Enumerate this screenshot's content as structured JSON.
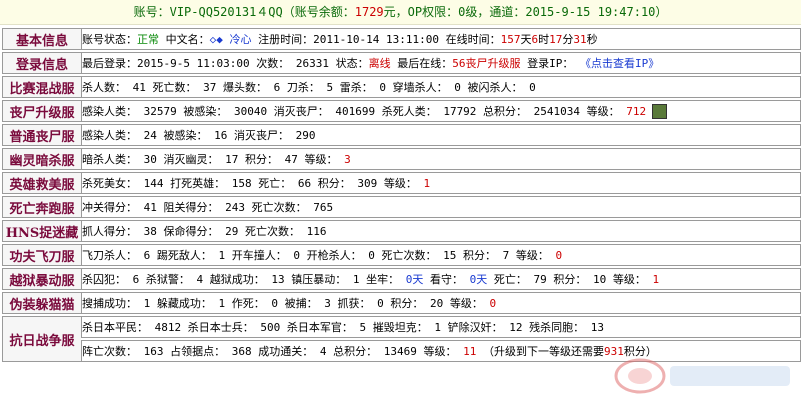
{
  "topbar": {
    "pre": "账号：VIP-QQ520131４QQ（账号余额：",
    "balance": "1729",
    "mid": "元，OP权限：0级，通道：",
    "datetime": "2015-9-15 19:47:10",
    "post": "）"
  },
  "rows": [
    {
      "label": "基本信息",
      "parts": [
        {
          "t": "账号状态：",
          "c": "kw"
        },
        {
          "t": "正常",
          "c": "green"
        },
        {
          "t": " 中文名：",
          "c": "kw"
        },
        {
          "t": "◇◆ 冷心",
          "c": "blue"
        },
        {
          "t": " 注册时间：2011-10-14 13:11:00  在线时间：",
          "c": "kw"
        },
        {
          "t": "157",
          "c": "red"
        },
        {
          "t": "天",
          "c": "kw"
        },
        {
          "t": "6",
          "c": "red"
        },
        {
          "t": "时",
          "c": "kw"
        },
        {
          "t": "17",
          "c": "red"
        },
        {
          "t": "分",
          "c": "kw"
        },
        {
          "t": "31",
          "c": "red"
        },
        {
          "t": "秒",
          "c": "kw"
        }
      ]
    },
    {
      "label": "登录信息",
      "parts": [
        {
          "t": "最后登录：2015-9-5 11:03:00 次数： 26331 状态：",
          "c": "kw"
        },
        {
          "t": "离线",
          "c": "red"
        },
        {
          "t": " 最后在线：",
          "c": "kw"
        },
        {
          "t": "56丧尸升级服",
          "c": "red"
        },
        {
          "t": " 登录IP： ",
          "c": "kw"
        },
        {
          "t": "《点击查看IP》",
          "c": "blue"
        }
      ]
    },
    {
      "label": "比赛混战服",
      "parts": [
        {
          "t": "杀人数： 41 死亡数： 37 爆头数： 6 刀杀： 5 雷杀： 0 穿墙杀人： 0 被闪杀人： 0",
          "c": "kw"
        }
      ]
    },
    {
      "label": "丧尸升级服",
      "parts": [
        {
          "t": "感染人类： 32579 被感染： 30040 消灭丧尸： 401699 杀死人类： 17792 总积分： 2541034 等级： ",
          "c": "kw"
        },
        {
          "t": "712",
          "c": "red"
        }
      ],
      "avatar": true
    },
    {
      "label": "普通丧尸服",
      "parts": [
        {
          "t": "感染人类： 24 被感染： 16 消灭丧尸： 290",
          "c": "kw"
        }
      ]
    },
    {
      "label": "幽灵暗杀服",
      "parts": [
        {
          "t": "暗杀人类： 30 消灭幽灵： 17 积分： 47 等级： ",
          "c": "kw"
        },
        {
          "t": "3",
          "c": "red"
        }
      ]
    },
    {
      "label": "英雄救美服",
      "parts": [
        {
          "t": "杀死美女： 144 打死英雄： 158 死亡： 66 积分： 309 等级： ",
          "c": "kw"
        },
        {
          "t": "1",
          "c": "red"
        }
      ]
    },
    {
      "label": "死亡奔跑服",
      "parts": [
        {
          "t": "冲关得分： 41 阻关得分： 243 死亡次数： 765",
          "c": "kw"
        }
      ]
    },
    {
      "label": "HNS捉迷藏",
      "parts": [
        {
          "t": "抓人得分： 38 保命得分： 29 死亡次数： 116",
          "c": "kw"
        }
      ]
    },
    {
      "label": "功夫飞刀服",
      "parts": [
        {
          "t": "飞刀杀人： 6 踢死敌人： 1 开车撞人： 0 开枪杀人： 0 死亡次数： 15 积分： 7 等级： ",
          "c": "kw"
        },
        {
          "t": "0",
          "c": "red"
        }
      ]
    },
    {
      "label": "越狱暴动服",
      "parts": [
        {
          "t": "杀囚犯： 6 杀狱警： 4 越狱成功： 13 镇压暴动： 1 坐牢： ",
          "c": "kw"
        },
        {
          "t": "0天",
          "c": "blue"
        },
        {
          "t": " 看守： ",
          "c": "kw"
        },
        {
          "t": "0天",
          "c": "blue"
        },
        {
          "t": " 死亡： 79 积分： 10 等级： ",
          "c": "kw"
        },
        {
          "t": "1",
          "c": "red"
        }
      ]
    },
    {
      "label": "伪装躲猫猫",
      "parts": [
        {
          "t": "搜捕成功： 1 躲藏成功： 1 作死： 0 被捕： 3 抓获： 0 积分： 20 等级： ",
          "c": "kw"
        },
        {
          "t": "0",
          "c": "red"
        }
      ]
    }
  ],
  "war": {
    "label": "抗日战争服",
    "line1": [
      {
        "t": "杀日本平民： 4812 杀日本士兵： 500 杀日本军官： 5 摧毁坦克： 1 铲除汉奸： 12 残杀同胞： 13",
        "c": "kw"
      }
    ],
    "line2": [
      {
        "t": "阵亡次数： 163 占领据点： 368 成功通关： 4 总积分： 13469 等级： ",
        "c": "kw"
      },
      {
        "t": "11",
        "c": "red"
      },
      {
        "t": " （升级到下一等级还需要",
        "c": "kw"
      },
      {
        "t": "931",
        "c": "red"
      },
      {
        "t": "积分）",
        "c": "kw"
      }
    ]
  }
}
